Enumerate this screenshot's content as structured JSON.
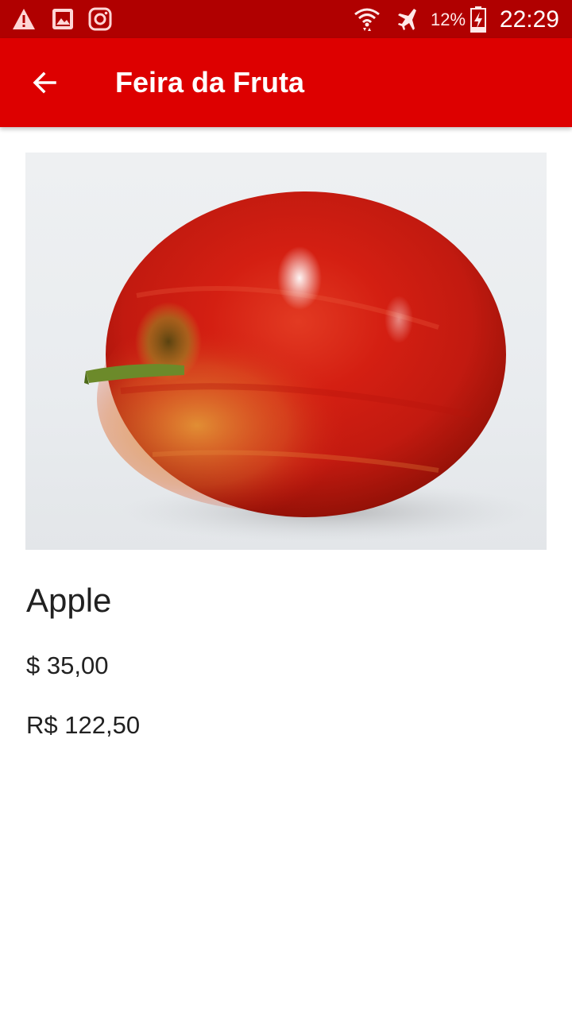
{
  "status_bar": {
    "notification_icons": [
      "warning-icon",
      "image-icon",
      "instagram-icon"
    ],
    "system_icons": [
      "wifi-icon",
      "airplane-mode-icon",
      "battery-charging-icon"
    ],
    "battery_percent": "12%",
    "time": "22:29"
  },
  "app_bar": {
    "title": "Feira da Fruta",
    "back_icon": "arrow-back-icon",
    "background_color": "#dd0000"
  },
  "product": {
    "image_alt": "Apple",
    "name": "Apple",
    "price_usd": "$ 35,00",
    "price_brl": "R$ 122,50"
  },
  "colors": {
    "status_bar": "#b00000",
    "app_bar": "#dd0000",
    "text_primary": "#212121"
  }
}
